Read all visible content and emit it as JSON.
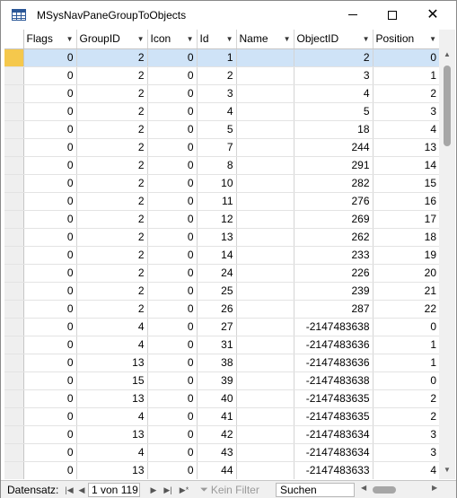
{
  "window": {
    "title": "MSysNavPaneGroupToObjects",
    "minimize_glyph": "—",
    "maximize_glyph": "□",
    "close_glyph": "✕"
  },
  "grid": {
    "columns": [
      "Flags",
      "GroupID",
      "Icon",
      "Id",
      "Name",
      "ObjectID",
      "Position"
    ],
    "current_row_index": 0,
    "rows": [
      [
        "0",
        "2",
        "0",
        "1",
        "",
        "2",
        "0"
      ],
      [
        "0",
        "2",
        "0",
        "2",
        "",
        "3",
        "1"
      ],
      [
        "0",
        "2",
        "0",
        "3",
        "",
        "4",
        "2"
      ],
      [
        "0",
        "2",
        "0",
        "4",
        "",
        "5",
        "3"
      ],
      [
        "0",
        "2",
        "0",
        "5",
        "",
        "18",
        "4"
      ],
      [
        "0",
        "2",
        "0",
        "7",
        "",
        "244",
        "13"
      ],
      [
        "0",
        "2",
        "0",
        "8",
        "",
        "291",
        "14"
      ],
      [
        "0",
        "2",
        "0",
        "10",
        "",
        "282",
        "15"
      ],
      [
        "0",
        "2",
        "0",
        "11",
        "",
        "276",
        "16"
      ],
      [
        "0",
        "2",
        "0",
        "12",
        "",
        "269",
        "17"
      ],
      [
        "0",
        "2",
        "0",
        "13",
        "",
        "262",
        "18"
      ],
      [
        "0",
        "2",
        "0",
        "14",
        "",
        "233",
        "19"
      ],
      [
        "0",
        "2",
        "0",
        "24",
        "",
        "226",
        "20"
      ],
      [
        "0",
        "2",
        "0",
        "25",
        "",
        "239",
        "21"
      ],
      [
        "0",
        "2",
        "0",
        "26",
        "",
        "287",
        "22"
      ],
      [
        "0",
        "4",
        "0",
        "27",
        "",
        "-2147483638",
        "0"
      ],
      [
        "0",
        "4",
        "0",
        "31",
        "",
        "-2147483636",
        "1"
      ],
      [
        "0",
        "13",
        "0",
        "38",
        "",
        "-2147483636",
        "1"
      ],
      [
        "0",
        "15",
        "0",
        "39",
        "",
        "-2147483638",
        "0"
      ],
      [
        "0",
        "13",
        "0",
        "40",
        "",
        "-2147483635",
        "2"
      ],
      [
        "0",
        "4",
        "0",
        "41",
        "",
        "-2147483635",
        "2"
      ],
      [
        "0",
        "13",
        "0",
        "42",
        "",
        "-2147483634",
        "3"
      ],
      [
        "0",
        "4",
        "0",
        "43",
        "",
        "-2147483634",
        "3"
      ],
      [
        "0",
        "13",
        "0",
        "44",
        "",
        "-2147483633",
        "4"
      ]
    ]
  },
  "navbar": {
    "label": "Datensatz:",
    "first_glyph": "|◀",
    "prev_glyph": "◀",
    "record": "1 von 119",
    "next_glyph": "▶",
    "last_glyph": "▶|",
    "new_glyph": "▶*",
    "filter_icon": "funnel-icon",
    "filter_label": "Kein Filter",
    "search_value": "Suchen"
  },
  "icons": {
    "table": "table-icon",
    "dropdown": "▼",
    "scroll_up": "▲",
    "scroll_down": "▼",
    "scroll_left": "◀",
    "scroll_right": "▶"
  },
  "colors": {
    "current_row": "#cfe3f7",
    "current_selector": "#f5c84c",
    "access_blue": "#2b5797"
  }
}
